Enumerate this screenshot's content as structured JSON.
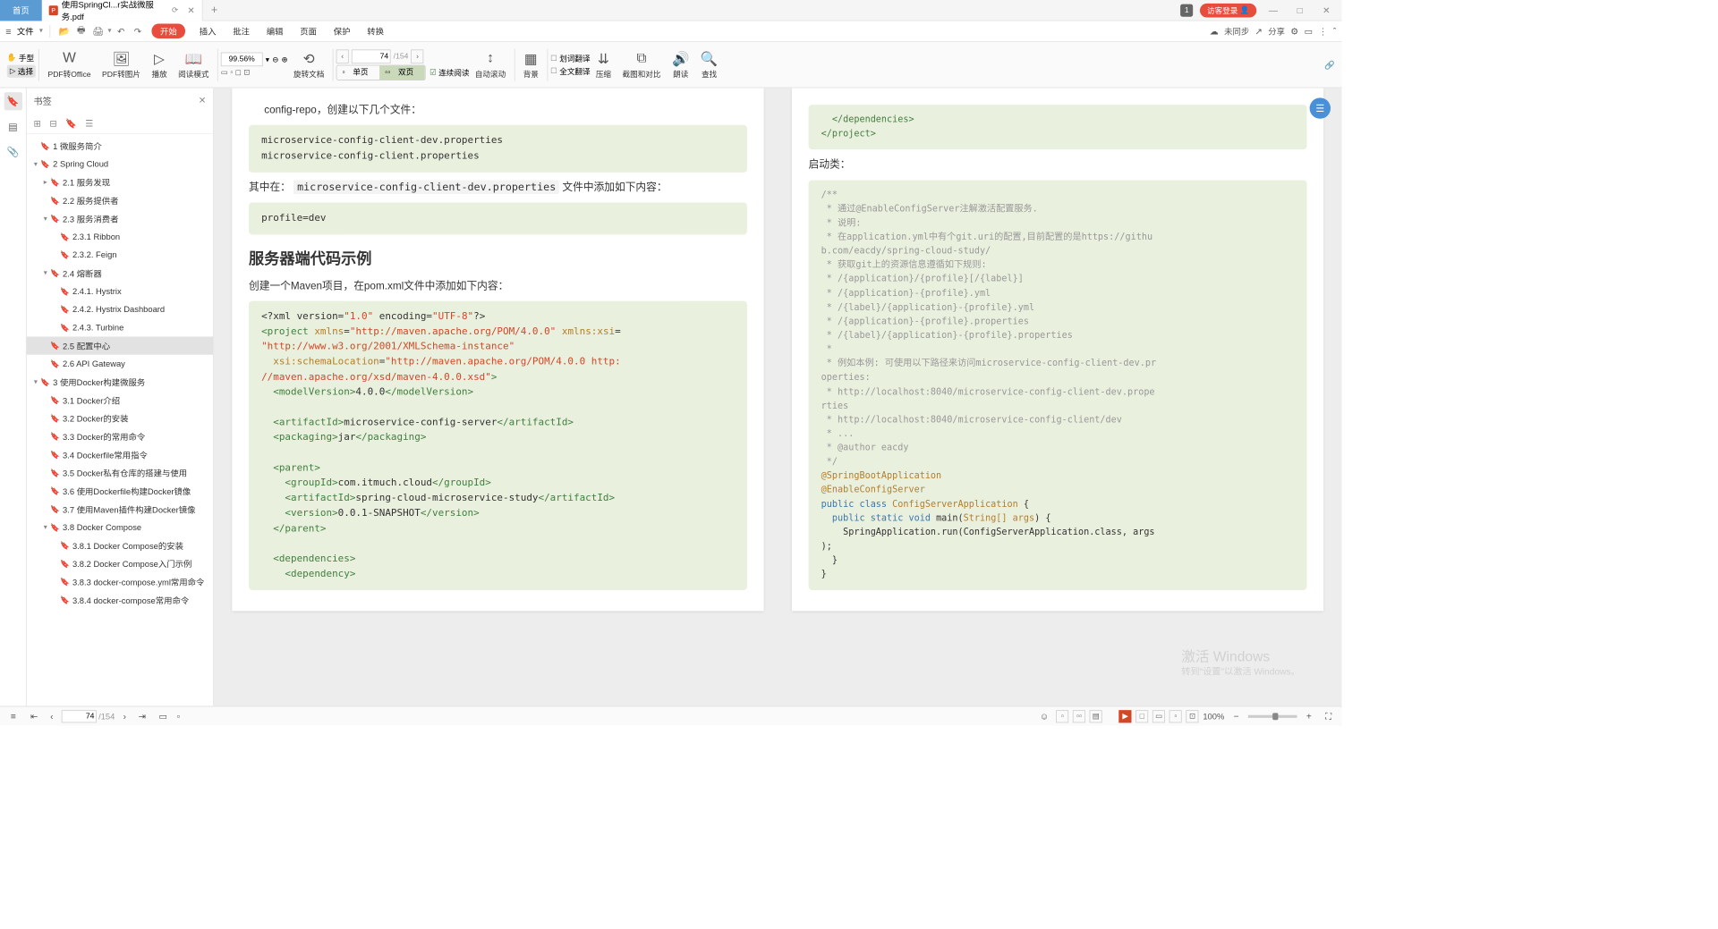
{
  "titlebar": {
    "home": "首页",
    "doc_tab": "使用SpringCl...r实战微服务.pdf",
    "badge": "1",
    "login": "访客登录"
  },
  "menubar": {
    "file": "文件",
    "start": "开始",
    "items": [
      "插入",
      "批注",
      "编辑",
      "页面",
      "保护",
      "转换"
    ],
    "right_unsync": "未同步",
    "right_share": "分享"
  },
  "toolbar": {
    "hand": "手型",
    "select": "选择",
    "pdf2office": "PDF转Office",
    "pdf2img": "PDF转图片",
    "play": "播放",
    "readmode": "阅读模式",
    "zoom_value": "99.56%",
    "rotate": "旋转文档",
    "page_current": "74",
    "page_total": "/154",
    "single": "单页",
    "double": "双页",
    "cont_read": "连续阅读",
    "autoscroll": "自动滚动",
    "background": "背景",
    "word_trans": "划词翻译",
    "full_trans": "全文翻译",
    "compress": "压缩",
    "compare": "截图和对比",
    "read_aloud": "朗读",
    "find": "查找"
  },
  "bookmarks": {
    "title": "书签",
    "tree": [
      {
        "lvl": 1,
        "exp": "",
        "lbl": "1 微服务简介"
      },
      {
        "lvl": 1,
        "exp": "▾",
        "lbl": "2 Spring Cloud"
      },
      {
        "lvl": 2,
        "exp": "▸",
        "lbl": "2.1 服务发现"
      },
      {
        "lvl": 2,
        "exp": "",
        "lbl": "2.2 服务提供者"
      },
      {
        "lvl": 2,
        "exp": "▾",
        "lbl": "2.3 服务消费者"
      },
      {
        "lvl": 3,
        "exp": "",
        "lbl": "2.3.1 Ribbon"
      },
      {
        "lvl": 3,
        "exp": "",
        "lbl": "2.3.2. Feign"
      },
      {
        "lvl": 2,
        "exp": "▾",
        "lbl": "2.4 熔断器"
      },
      {
        "lvl": 3,
        "exp": "",
        "lbl": "2.4.1. Hystrix"
      },
      {
        "lvl": 3,
        "exp": "",
        "lbl": "2.4.2. Hystrix Dashboard"
      },
      {
        "lvl": 3,
        "exp": "",
        "lbl": "2.4.3. Turbine"
      },
      {
        "lvl": 2,
        "exp": "",
        "lbl": "2.5 配置中心",
        "active": true
      },
      {
        "lvl": 2,
        "exp": "",
        "lbl": "2.6 API Gateway"
      },
      {
        "lvl": 1,
        "exp": "▾",
        "lbl": "3 使用Docker构建微服务"
      },
      {
        "lvl": 2,
        "exp": "",
        "lbl": "3.1 Docker介绍"
      },
      {
        "lvl": 2,
        "exp": "",
        "lbl": "3.2 Docker的安装"
      },
      {
        "lvl": 2,
        "exp": "",
        "lbl": "3.3 Docker的常用命令"
      },
      {
        "lvl": 2,
        "exp": "",
        "lbl": "3.4 Dockerfile常用指令"
      },
      {
        "lvl": 2,
        "exp": "",
        "lbl": "3.5 Docker私有仓库的搭建与使用"
      },
      {
        "lvl": 2,
        "exp": "",
        "lbl": "3.6 使用Dockerfile构建Docker镜像"
      },
      {
        "lvl": 2,
        "exp": "",
        "lbl": "3.7 使用Maven插件构建Docker镜像"
      },
      {
        "lvl": 2,
        "exp": "▾",
        "lbl": "3.8 Docker Compose"
      },
      {
        "lvl": 3,
        "exp": "",
        "lbl": "3.8.1 Docker Compose的安装"
      },
      {
        "lvl": 3,
        "exp": "",
        "lbl": "3.8.2 Docker Compose入门示例"
      },
      {
        "lvl": 3,
        "exp": "",
        "lbl": "3.8.3 docker-compose.yml常用命令"
      },
      {
        "lvl": 3,
        "exp": "",
        "lbl": "3.8.4 docker-compose常用命令"
      }
    ]
  },
  "doc_left": {
    "intro": "config-repo，创建以下几个文件：",
    "files": "microservice-config-client-dev.properties\nmicroservice-config-client.properties",
    "mid1a": "其中在：",
    "mid1_code": "microservice-config-client-dev.properties",
    "mid1b": "文件中添加如下内容：",
    "profile": "profile=dev",
    "h2": "服务器端代码示例",
    "maven_desc": "创建一个Maven项目，在pom.xml文件中添加如下内容："
  },
  "doc_right": {
    "startup": "启动类："
  },
  "statusbar": {
    "page_current": "74",
    "page_total": "/154",
    "zoom": "100%"
  },
  "watermark": {
    "l1": "激活 Windows",
    "l2": "转到\"设置\"以激活 Windows。"
  }
}
